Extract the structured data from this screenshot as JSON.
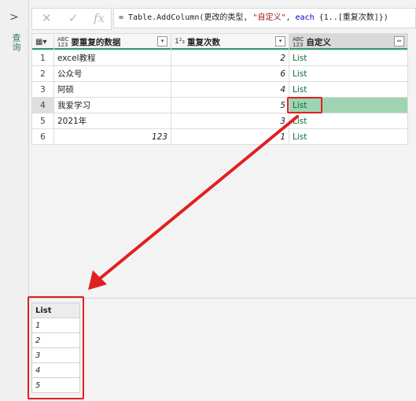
{
  "sidebar": {
    "collapsed_label": "查询"
  },
  "formula_bar": {
    "text_before": "= Table.AddColumn(更改的类型, ",
    "string_literal": "\"自定义\"",
    "comma": ", ",
    "keyword": "each",
    "text_after": " {1..[重复次数]})"
  },
  "columns": [
    {
      "type": "ABC\n123",
      "name": "要重复的数据"
    },
    {
      "type": "1²₃",
      "name": "重复次数"
    },
    {
      "type": "ABC\n123",
      "name": "自定义"
    }
  ],
  "rows": [
    {
      "n": "1",
      "data": "excel教程",
      "count": "2",
      "custom": "List"
    },
    {
      "n": "2",
      "data": "公众号",
      "count": "6",
      "custom": "List"
    },
    {
      "n": "3",
      "data": "阿硕",
      "count": "4",
      "custom": "List"
    },
    {
      "n": "4",
      "data": "我爱学习",
      "count": "5",
      "custom": "List"
    },
    {
      "n": "5",
      "data": "2021年",
      "count": "3",
      "custom": "List"
    },
    {
      "n": "6",
      "data": "123",
      "count": "1",
      "custom": "List"
    }
  ],
  "preview": {
    "header": "List",
    "values": [
      "1",
      "2",
      "3",
      "4",
      "5"
    ]
  }
}
